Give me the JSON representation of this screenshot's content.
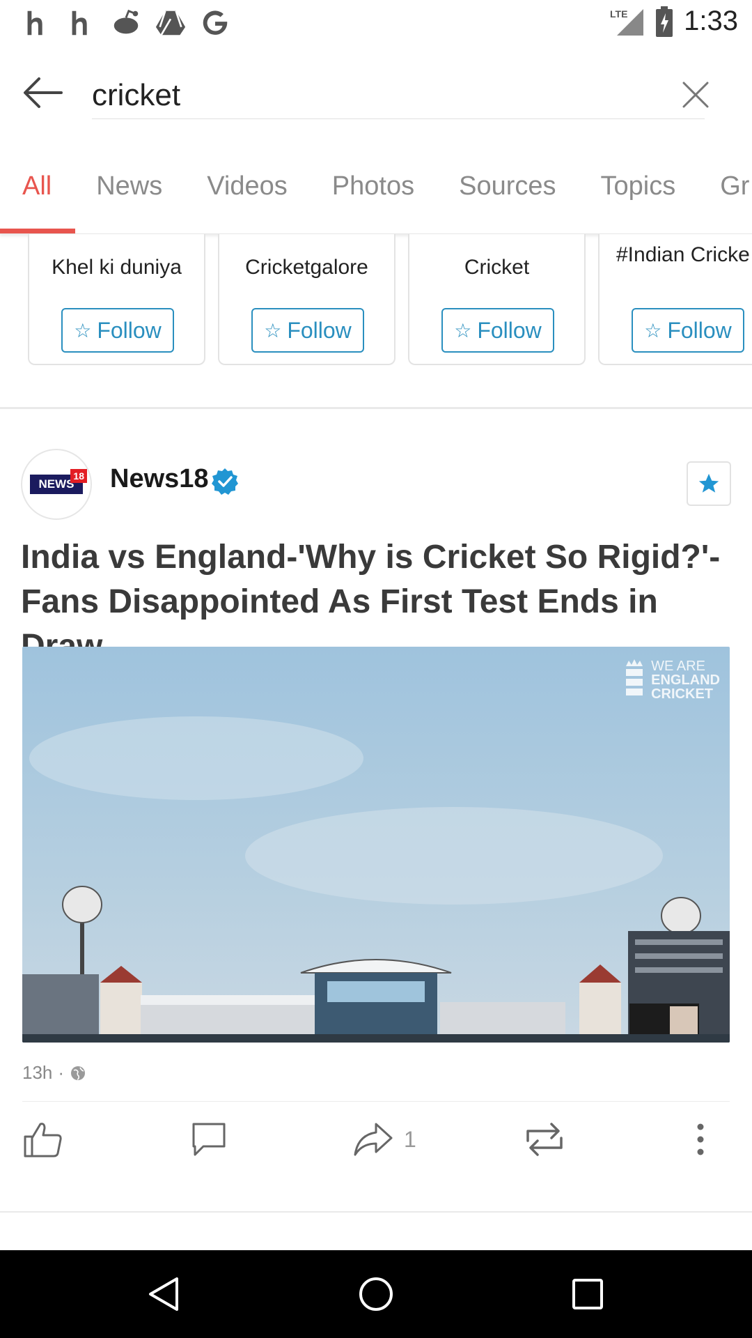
{
  "status_bar": {
    "time": "1:33",
    "network": "LTE",
    "icons": [
      "hipchat-icon",
      "hipchat-icon",
      "reddit-icon",
      "drive-icon",
      "google-icon"
    ]
  },
  "search": {
    "query": "cricket"
  },
  "tabs": [
    "All",
    "News",
    "Videos",
    "Photos",
    "Sources",
    "Topics",
    "Gr"
  ],
  "cards": [
    {
      "name": "Khel ki duniya",
      "follow": "Follow"
    },
    {
      "name": "Cricketgalore",
      "follow": "Follow"
    },
    {
      "name": "Cricket",
      "follow": "Follow"
    },
    {
      "name": "#Indian Cricke J",
      "follow": "Follow"
    }
  ],
  "post": {
    "source": "News18",
    "logo_text": "NEWS",
    "logo_num": "18",
    "headline": "India vs England-'Why is Cricket So Rigid?'- Fans Disappointed As First Test Ends in Draw",
    "watermark_line1": "WE ARE",
    "watermark_line2": "ENGLAND",
    "watermark_line3": "CRICKET",
    "time": "13h",
    "dot": "·",
    "share_count": "1"
  },
  "colors": {
    "accent": "#e8554e",
    "follow": "#2a8fbf",
    "verified": "#2196d3"
  }
}
